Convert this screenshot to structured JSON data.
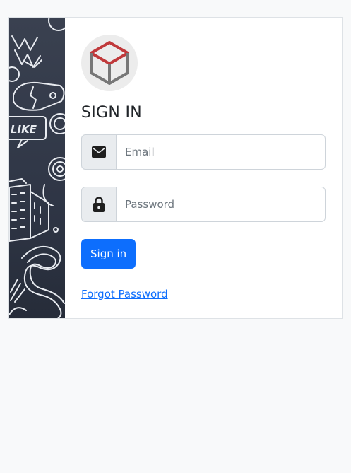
{
  "login": {
    "title": "SIGN IN",
    "email": {
      "placeholder": "Email",
      "value": "",
      "icon": "envelope-icon"
    },
    "password": {
      "placeholder": "Password",
      "value": "",
      "icon": "lock-icon"
    },
    "submit_label": "Sign in",
    "forgot_label": "Forgot Password"
  },
  "logo": {
    "icon": "cube-icon"
  },
  "side_panel": {
    "doodle_text": "LIKE"
  },
  "colors": {
    "accent": "#0d6efd",
    "logo_top": "#c0393b",
    "logo_body": "#777777",
    "panel": "#2f3646"
  }
}
